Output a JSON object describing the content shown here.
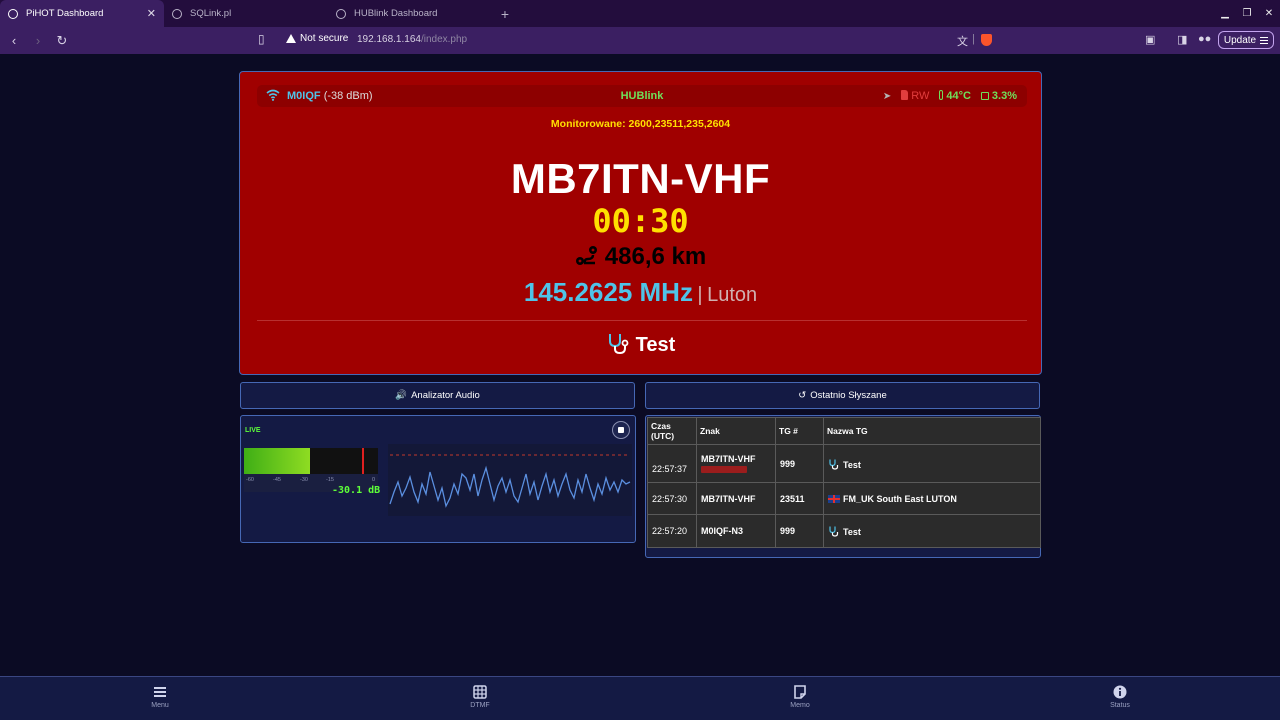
{
  "browser": {
    "tabs": [
      {
        "title": "PiHOT Dashboard",
        "active": true
      },
      {
        "title": "SQLink.pl",
        "active": false
      },
      {
        "title": "HUBlink Dashboard",
        "active": false
      }
    ],
    "security_label": "Not secure",
    "url_host": "192.168.1.164",
    "url_path": "/index.php",
    "update_label": "Update"
  },
  "status": {
    "callsign": "M0IQF",
    "signal": "(-38 dBm)",
    "title": "HUBlink",
    "storage": "RW",
    "temperature": "44°C",
    "cpu": "3.3%"
  },
  "monitored": "Monitorowane: 2600,23511,235,2604",
  "current": {
    "callsign": "MB7ITN-VHF",
    "timer": "00:30",
    "distance": "486,6 km",
    "frequency": "145.2625 MHz",
    "separator": "|",
    "location": "Luton",
    "talkgroup": "Test"
  },
  "panels": {
    "audio_title": "Analizator Audio",
    "history_title": "Ostatnio Słyszane"
  },
  "audio": {
    "live_label": "LIVE",
    "level_fraction": 0.49,
    "peak_fraction": 0.88,
    "scale": [
      "-60",
      "-45",
      "-30",
      "-15",
      "0"
    ],
    "db_readout": "-30.1 dB"
  },
  "history": {
    "headers": [
      "Czas (UTC)",
      "Znak",
      "TG #",
      "Nazwa TG"
    ],
    "rows": [
      {
        "time": "22:57:37",
        "sign": "MB7ITN-VHF",
        "tg": "999",
        "name": "Test",
        "icon": "stethoscope-icon"
      },
      {
        "time": "22:57:30",
        "sign": "MB7ITN-VHF",
        "tg": "23511",
        "name": "FM_UK South East LUTON",
        "icon": "uk-flag-icon"
      },
      {
        "time": "22:57:20",
        "sign": "M0IQF-N3",
        "tg": "999",
        "name": "Test",
        "icon": "stethoscope-icon"
      }
    ]
  },
  "bottom_nav": [
    {
      "label": "Menu",
      "icon": "menu-icon"
    },
    {
      "label": "DTMF",
      "icon": "keypad-icon"
    },
    {
      "label": "Memo",
      "icon": "memo-icon"
    },
    {
      "label": "Status",
      "icon": "info-icon"
    }
  ],
  "colors": {
    "card_red": "#a00000",
    "accent_cyan": "#4fc3e8",
    "accent_yellow": "#ffe000",
    "accent_green": "#6fe05a",
    "panel_bg": "#141a44",
    "page_bg": "#0b0b24"
  }
}
